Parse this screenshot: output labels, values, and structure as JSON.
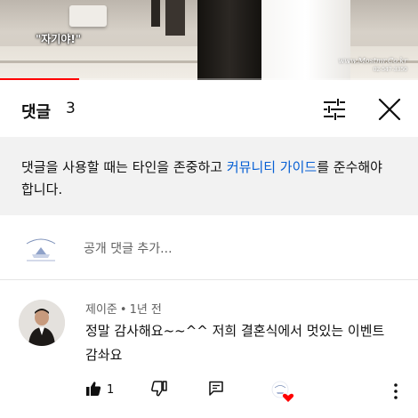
{
  "video": {
    "caption": "\"자기야!\"",
    "watermark_site": "www.Mostmr.Co.kr",
    "watermark_phone": "02-547-3350",
    "progress_fraction": 0.19,
    "progress_color": "#ff0000"
  },
  "header": {
    "title": "댓글",
    "count": "3",
    "sort_icon": "sort-sliders-icon",
    "close_icon": "close-icon"
  },
  "guideline": {
    "text_before": "댓글을 사용할 때는 타인을 존중하고 ",
    "link": "커뮤니티 가이드",
    "text_after": "를 준수해야 합니다.",
    "link_color": "#065fd4"
  },
  "add_comment": {
    "channel_logo": "MUSICAL WEDDING",
    "placeholder": "공개 댓글 추가..."
  },
  "comments": [
    {
      "author": "제이준",
      "time": "1년 전",
      "text": "정말 감사해요~~^^ 저희 결혼식에서 멋있는 이벤트 감솨요",
      "likes": "1",
      "icons": [
        "thumb-up-icon",
        "thumb-down-icon",
        "reply-icon",
        "creator-heart-icon",
        "more-vert-icon"
      ]
    }
  ]
}
